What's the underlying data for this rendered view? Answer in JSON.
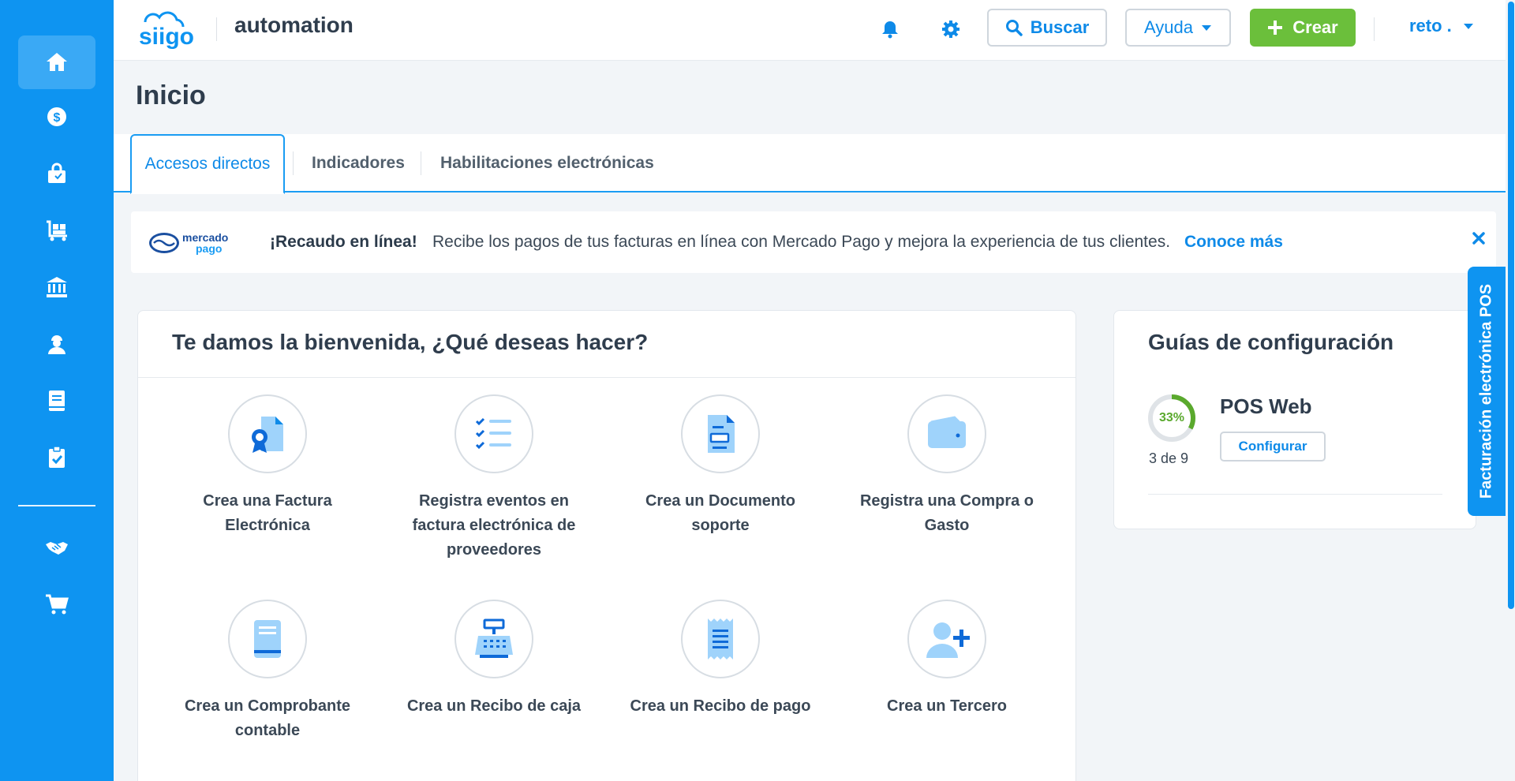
{
  "app": {
    "company_name": "automation",
    "logo_text": "siigo"
  },
  "colors": {
    "brand_blue": "#0e94f1",
    "link_blue": "#0e8ae8",
    "create_green": "#6bbf3b",
    "progress_green": "#5aa92d"
  },
  "sidebar": {
    "items": [
      {
        "icon": "home-icon",
        "active": true
      },
      {
        "icon": "money-icon"
      },
      {
        "icon": "shopping-bag-icon"
      },
      {
        "icon": "inventory-icon"
      },
      {
        "icon": "bank-icon"
      },
      {
        "icon": "employee-icon"
      },
      {
        "icon": "book-icon"
      },
      {
        "icon": "clipboard-check-icon"
      },
      {
        "icon": "handshake-icon"
      },
      {
        "icon": "cart-icon"
      }
    ]
  },
  "header": {
    "search_label": "Buscar",
    "help_label": "Ayuda",
    "create_label": "Crear",
    "user_label": "reto ."
  },
  "page": {
    "title": "Inicio"
  },
  "tabs": [
    {
      "label": "Accesos directos",
      "active": true
    },
    {
      "label": "Indicadores"
    },
    {
      "label": "Habilitaciones electrónicas"
    }
  ],
  "banner": {
    "logo_line1": "mercado",
    "logo_line2": "pago",
    "strong": "¡Recaudo en línea!",
    "text": "Recibe los pagos de tus facturas en línea con Mercado Pago y mejora la experiencia de tus clientes.",
    "link": "Conoce más"
  },
  "welcome": {
    "title": "Te damos la bienvenida, ¿Qué deseas hacer?",
    "actions": [
      {
        "label": "Crea una Factura Electrónica",
        "icon": "invoice-certificate-icon"
      },
      {
        "label": "Registra eventos en factura electrónica de proveedores",
        "icon": "checklist-icon"
      },
      {
        "label": "Crea un Documento soporte",
        "icon": "support-document-icon"
      },
      {
        "label": "Registra una Compra o Gasto",
        "icon": "wallet-icon"
      },
      {
        "label": "Crea un Comprobante contable",
        "icon": "accounting-voucher-icon"
      },
      {
        "label": "Crea un Recibo de caja",
        "icon": "cash-register-icon"
      },
      {
        "label": "Crea un Recibo de pago",
        "icon": "payment-receipt-icon"
      },
      {
        "label": "Crea un Tercero",
        "icon": "add-person-icon"
      }
    ]
  },
  "guides": {
    "title": "Guías de configuración",
    "item": {
      "name": "POS Web",
      "percent": 33,
      "percent_label": "33%",
      "count": "3 de 9",
      "button": "Configurar"
    }
  },
  "side_tab": {
    "label": "Facturación electrónica POS"
  }
}
